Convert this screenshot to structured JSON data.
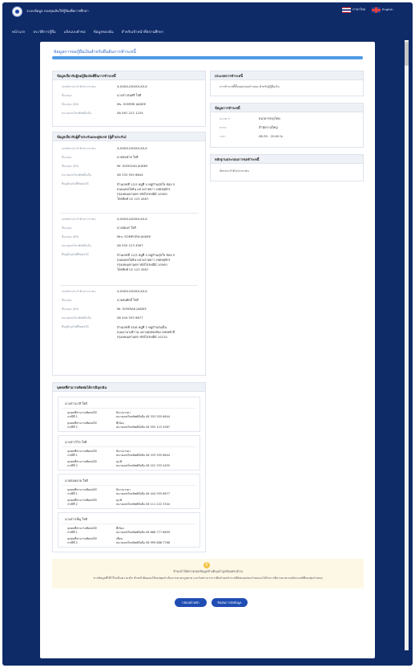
{
  "topbar": {
    "site_title": "ระบบข้อมูล กองทุนเงินให้กู้ยืมเพื่อการศึกษา",
    "lang_th": "ภาษาไทย",
    "lang_en": "English"
  },
  "nav": [
    "หน้าแรก",
    "ประวัติการกู้ยืม",
    "แจ้งแบบคำขอ",
    "ข้อมูลของฉัน",
    "สำหรับเจ้าหน้าที่สถานศึกษา"
  ],
  "page": {
    "title": "ข้อมูลการขอกู้ยืมเงินสำหรับยืนยันการชำระหนี้",
    "progress": 1
  },
  "borrower": {
    "heading": "ข้อมูลเกี่ยวกับผู้ขอกู้ยืมเงินที่ยื่นการชำระหนี้",
    "rows": [
      {
        "label": "เลขบัตรประจำตัวประชาชน",
        "value": "X-XXXX-XXXXX-XX-X"
      },
      {
        "label": "ชื่อ-สกุล",
        "value": "นางสาวสมศรี ใจดี"
      },
      {
        "label": "ชื่อ-สกุล (EN)",
        "value": "Ms. SOMSRI JAIDEE"
      },
      {
        "label": "หมายเลขโทรศัพท์มือถือ",
        "value": "08 567 222 1234"
      }
    ]
  },
  "guarantors": {
    "heading": "ข้อมูลเกี่ยวกับผู้ค้ำประกันและคู่สมรส (ผู้ค้ำประกัน)",
    "people": [
      {
        "rows": [
          {
            "label": "เลขบัตรประจำตัวประชาชน",
            "value": "X-XXXX-XXXXX-XX-X"
          },
          {
            "label": "ชื่อ-สกุล",
            "value": "นายสมชาย ใจดี"
          },
          {
            "label": "ชื่อ-สกุล (EN)",
            "value": "Mr. SOMCHAI JAIDEE"
          },
          {
            "label": "หมายเลขโทรศัพท์มือถือ",
            "value": "08 333 555 6644"
          },
          {
            "label": "ที่อยู่ปัจจุบันที่ติดต่อได้",
            "value": "บ้านเลขที่ 12/3 หมู่ที่ 4 หมู่บ้านสุขใจ ซอย 5\nถนนพหลโยธิน แขวงลาดยาว เขตจตุจักร\nกรุงเทพมหานคร รหัสไปรษณีย์ 10900\nโทรศัพท์ 02 123 4567"
          }
        ]
      },
      {
        "rows": [
          {
            "label": "เลขบัตรประจำตัวประชาชน",
            "value": "X-XXXX-XXXXX-XX-X"
          },
          {
            "label": "ชื่อ-สกุล",
            "value": "นางสมพร ใจดี"
          },
          {
            "label": "ชื่อ-สกุล (EN)",
            "value": "Mrs. SOMPORN JAIDEE"
          },
          {
            "label": "หมายเลขโทรศัพท์มือถือ",
            "value": "08 555 123 4567"
          },
          {
            "label": "ที่อยู่ปัจจุบันที่ติดต่อได้",
            "value": "บ้านเลขที่ 12/3 หมู่ที่ 4 หมู่บ้านสุขใจ ซอย 5\nถนนพหลโยธิน แขวงลาดยาว เขตจตุจักร\nกรุงเทพมหานคร รหัสไปรษณีย์ 10900\nโทรศัพท์ 02 123 4567"
          }
        ]
      },
      {
        "rows": [
          {
            "label": "เลขบัตรประจำตัวประชาชน",
            "value": "X-XXXX-XXXXX-XX-X"
          },
          {
            "label": "ชื่อ-สกุล",
            "value": "นายสมศักดิ์ ใจดี"
          },
          {
            "label": "ชื่อ-สกุล (EN)",
            "value": "Mr. SOMSAK JAIDEE"
          },
          {
            "label": "หมายเลขโทรศัพท์มือถือ",
            "value": "08 444 555 6677"
          },
          {
            "label": "ที่อยู่ปัจจุบันที่ติดต่อได้",
            "value": "บ้านเลขที่ 45/6 หมู่ที่ 2 หมู่บ้านร่มเย็น\nถนนงามวงศ์วาน แขวงทุ่งสองห้อง เขตหลักสี่\nกรุงเทพมหานคร รหัสไปรษณีย์ 10210"
          }
        ]
      }
    ]
  },
  "references": {
    "heading": "บุคคลที่สามารถติดต่อได้กรณีฉุกเฉิน",
    "people": [
      {
        "name": "นางสาวมาลี ใจดี",
        "c1_label": "บุคคลที่สามารถติดต่อได้\nกรณีที่ 1",
        "c1_value": "บิดา/มารดา\nหมายเลขโทรศัพท์มือถือ 08 333 555 6644",
        "c2_label": "บุคคลที่สามารถติดต่อได้\nกรณีที่ 2",
        "c2_value": "พี่/น้อง\nหมายเลขโทรศัพท์มือถือ 08 555 123 4567"
      },
      {
        "name": "นางสาววิไล ใจดี",
        "c1_label": "บุคคลที่สามารถติดต่อได้\nกรณีที่ 1",
        "c1_value": "บิดา/มารดา\nหมายเลขโทรศัพท์มือถือ 08 333 555 6644",
        "c2_label": "บุคคลที่สามารถติดต่อได้\nกรณีที่ 2",
        "c2_value": "ญาติ\nหมายเลขโทรศัพท์มือถือ 08 222 333 4455"
      },
      {
        "name": "นายสมหมาย ใจดี",
        "c1_label": "บุคคลที่สามารถติดต่อได้\nกรณีที่ 1",
        "c1_value": "บิดา/มารดา\nหมายเลขโทรศัพท์มือถือ 08 444 555 6677",
        "c2_label": "บุคคลที่สามารถติดต่อได้\nกรณีที่ 2",
        "c2_value": "ญาติ\nหมายเลขโทรศัพท์มือถือ 08 111 222 3344"
      },
      {
        "name": "นางสาวเพ็ญ ใจดี",
        "c1_label": "บุคคลที่สามารถติดต่อได้\nกรณีที่ 1",
        "c1_value": "พี่/น้อง\nหมายเลขโทรศัพท์มือถือ 08 666 777 8899",
        "c2_label": "บุคคลที่สามารถติดต่อได้\nกรณีที่ 2",
        "c2_value": "เพื่อน\nหมายเลขโทรศัพท์มือถือ 08 999 888 7766"
      }
    ]
  },
  "debt_type": {
    "heading": "ประเภทการชำระหนี้",
    "value": "การชำระหนี้ทั้งหมดก่อนกำหนด สำหรับผู้กู้ยืมเงิน"
  },
  "payment": {
    "heading": "ข้อมูลการชำระหนี้",
    "rows": [
      {
        "label": "ธนาคาร",
        "value": "ธนาคารกรุงไทย"
      },
      {
        "label": "สาขา",
        "value": "สำนักงานใหญ่"
      },
      {
        "label": "เวลา",
        "value": "08:30 - 20:00 น."
      }
    ]
  },
  "documents": {
    "heading": "หลักฐานประกอบการขอชำระหนี้",
    "value": "บัตรประจำตัวประชาชน"
  },
  "consent": {
    "icon": "!",
    "line1": "ข้าพเจ้าได้ตรวจสอบข้อมูลข้างต้นแล้วถูกต้องครบถ้วน",
    "line2": "หากข้อมูลที่ให้ไว้ไม่เป็นความจริง ข้าพเจ้ายินยอมให้กองทุนดำเนินการตามกฎหมาย และรับทราบว่าการยื่นคำขอชำระหนี้ทั้งหมดก่อนกำหนดจะได้รับการพิจารณาตามหลักเกณฑ์ที่กองทุนกำหนด"
  },
  "buttons": {
    "back": "กลับหน้าหลัก",
    "confirm": "ยืนยันการส่งข้อมูล"
  },
  "colors": {
    "nav_bg": "#0e2a67",
    "accent": "#1f4db3",
    "progress": "#4e9be6"
  }
}
